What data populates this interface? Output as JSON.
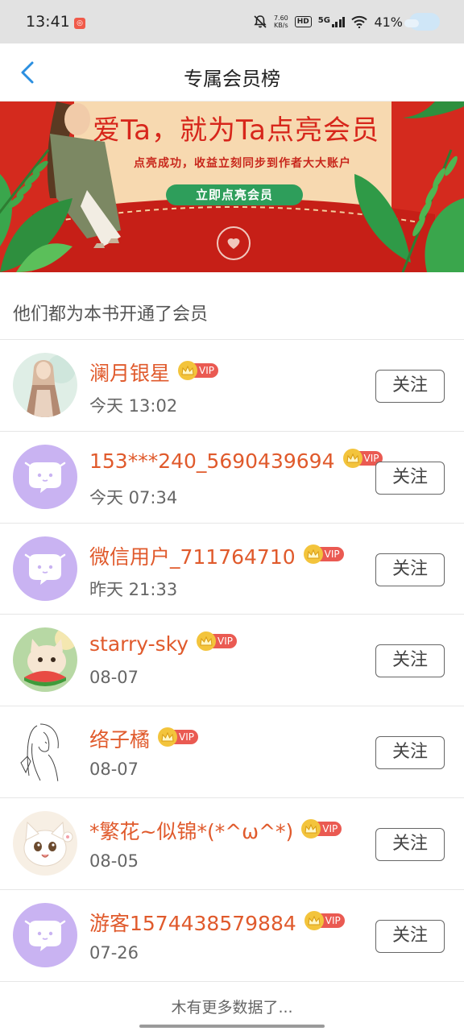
{
  "status_bar": {
    "time": "13:41",
    "net_speed_value": "7.60",
    "net_speed_unit": "KB/s",
    "hd_label": "HD",
    "network_label": "5G",
    "battery": "41%"
  },
  "nav": {
    "title": "专属会员榜"
  },
  "banner": {
    "headline": "爱Ta，就为Ta点亮会员",
    "subtitle": "点亮成功，收益立刻同步到作者大大账户",
    "cta_label": "立即点亮会员"
  },
  "section": {
    "title": "他们都为本书开通了会员"
  },
  "vip_label": "VIP",
  "follow_label": "关注",
  "members": [
    {
      "name": "澜月银星",
      "time": "今天 13:02",
      "avatar": "illustration-girl"
    },
    {
      "name": "153***240_5690439694",
      "time": "今天 07:34",
      "avatar": "default-chat-bubble"
    },
    {
      "name": "微信用户_711764710",
      "time": "昨天 21:33",
      "avatar": "default-chat-bubble"
    },
    {
      "name": "starry-sky",
      "time": "08-07",
      "avatar": "kitten-watermelon"
    },
    {
      "name": "络子橘",
      "time": "08-07",
      "avatar": "sketch-girl"
    },
    {
      "name": "*繁花~似锦*(*^ω^*)",
      "time": "08-05",
      "avatar": "cartoon-cat"
    },
    {
      "name": "游客1574438579884",
      "time": "07-26",
      "avatar": "default-chat-bubble"
    }
  ],
  "footer": {
    "no_more_text": "木有更多数据了..."
  },
  "colors": {
    "accent_blue": "#2b8fe0",
    "name_orange": "#e05a2c",
    "banner_red": "#d42a1e",
    "cta_green": "#2e9e5b",
    "vip_red": "#ea5a52",
    "default_avatar_purple": "#c9b3f2"
  }
}
